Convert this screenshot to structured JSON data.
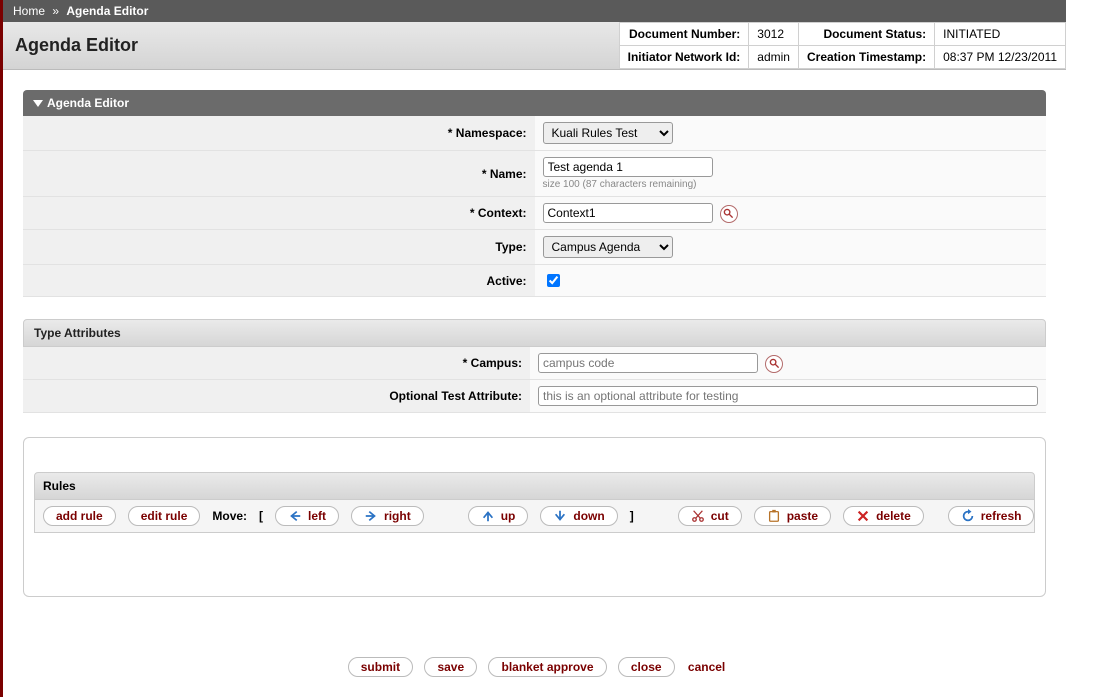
{
  "breadcrumb": {
    "home": "Home",
    "current": "Agenda Editor"
  },
  "page_title": "Agenda Editor",
  "doc_info": {
    "doc_number_label": "Document Number:",
    "doc_number": "3012",
    "doc_status_label": "Document Status:",
    "doc_status": "INITIATED",
    "initiator_label": "Initiator Network Id:",
    "initiator": "admin",
    "timestamp_label": "Creation Timestamp:",
    "timestamp": "08:37 PM 12/23/2011"
  },
  "sections": {
    "agenda_editor_title": "Agenda Editor",
    "type_attrs_title": "Type Attributes",
    "rules_title": "Rules"
  },
  "fields": {
    "namespace_label": "* Namespace:",
    "namespace_value": "Kuali Rules Test",
    "name_label": "* Name:",
    "name_value": "Test agenda 1",
    "name_hint": "size 100 (87 characters remaining)",
    "context_label": "* Context:",
    "context_value": "Context1",
    "type_label": "Type:",
    "type_value": "Campus Agenda",
    "active_label": "Active:",
    "active_checked": true,
    "campus_label": "* Campus:",
    "campus_placeholder": "campus code",
    "opt_attr_label": "Optional Test Attribute:",
    "opt_attr_placeholder": "this is an optional attribute for testing"
  },
  "toolbar": {
    "add_rule": "add rule",
    "edit_rule": "edit rule",
    "move_label": "Move:",
    "bracket_open": "[",
    "bracket_close": "]",
    "left": "left",
    "right": "right",
    "up": "up",
    "down": "down",
    "cut": "cut",
    "paste": "paste",
    "delete": "delete",
    "refresh": "refresh"
  },
  "footer": {
    "submit": "submit",
    "save": "save",
    "blanket_approve": "blanket approve",
    "close": "close",
    "cancel": "cancel"
  }
}
